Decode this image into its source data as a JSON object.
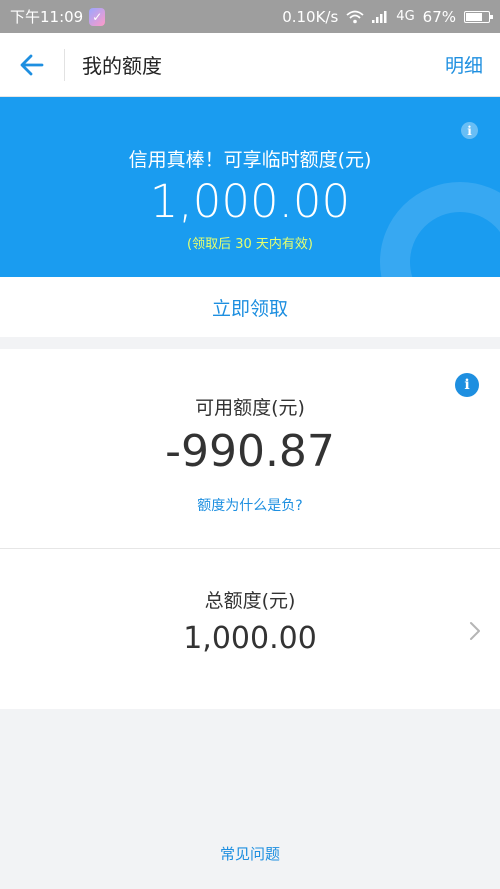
{
  "status_bar": {
    "time": "下午11:09",
    "network_speed": "0.10K/s",
    "network_type": "4G",
    "battery": "67%"
  },
  "nav": {
    "title": "我的额度",
    "right_action": "明细"
  },
  "banner": {
    "headline": "信用真棒！可享临时额度(元)",
    "amount": "1,000.00",
    "note": "(领取后 30 天内有效)",
    "info_icon": "i"
  },
  "claim_button": "立即领取",
  "available": {
    "label": "可用额度(元)",
    "value": "-990.87",
    "help_link": "额度为什么是负?",
    "info_icon": "i"
  },
  "total": {
    "label": "总额度(元)",
    "value": "1,000.00"
  },
  "faq_link": "常见问题",
  "colors": {
    "primary": "#1e8fe0",
    "banner": "#1a9cf0",
    "note": "#e6ff6e"
  }
}
